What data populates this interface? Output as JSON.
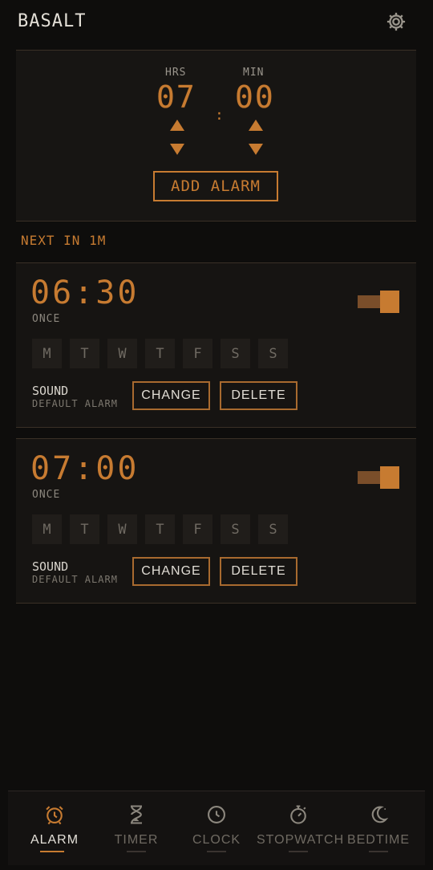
{
  "header": {
    "title": "BASALT",
    "settings_icon": "gear-icon"
  },
  "setter": {
    "hours_label": "HRS",
    "minutes_label": "MIN",
    "hours": "07",
    "minutes": "00",
    "separator": ":",
    "add_label": "ADD ALARM"
  },
  "next_alarm": "NEXT IN 1M",
  "alarms": [
    {
      "time": "06:30",
      "repeat": "ONCE",
      "enabled": true,
      "days": [
        "M",
        "T",
        "W",
        "T",
        "F",
        "S",
        "S"
      ],
      "sound_label": "SOUND",
      "sound_name": "DEFAULT ALARM",
      "change_label": "CHANGE",
      "delete_label": "DELETE"
    },
    {
      "time": "07:00",
      "repeat": "ONCE",
      "enabled": true,
      "days": [
        "M",
        "T",
        "W",
        "T",
        "F",
        "S",
        "S"
      ],
      "sound_label": "SOUND",
      "sound_name": "DEFAULT ALARM",
      "change_label": "CHANGE",
      "delete_label": "DELETE"
    }
  ],
  "nav": [
    {
      "label": "ALARM",
      "icon": "alarm-clock-icon",
      "active": true
    },
    {
      "label": "TIMER",
      "icon": "hourglass-icon",
      "active": false
    },
    {
      "label": "CLOCK",
      "icon": "clock-icon",
      "active": false
    },
    {
      "label": "STOPWATCH",
      "icon": "stopwatch-icon",
      "active": false
    },
    {
      "label": "BEDTIME",
      "icon": "moon-icon",
      "active": false
    }
  ],
  "colors": {
    "accent": "#c77b31",
    "background": "#0e0d0c",
    "card": "#161412"
  }
}
